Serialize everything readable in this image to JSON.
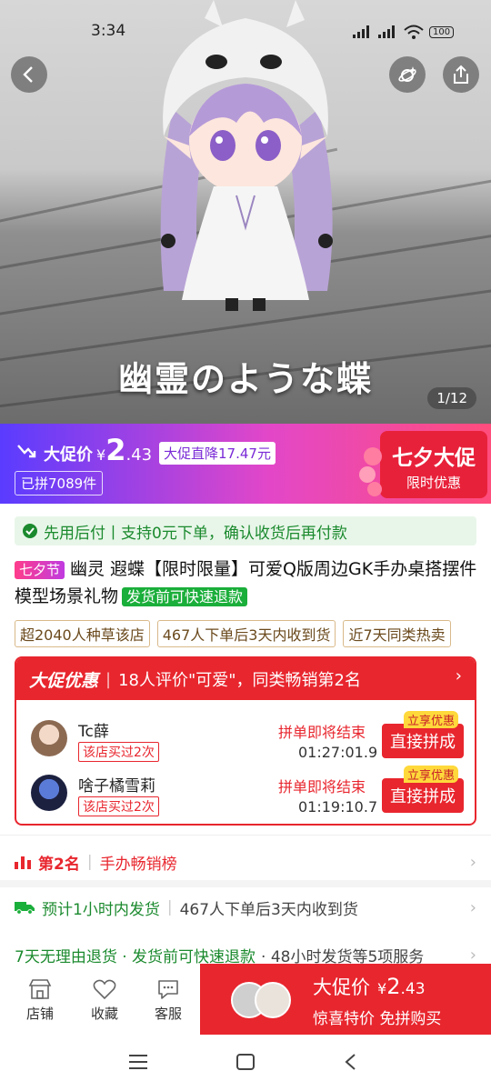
{
  "status_bar": {
    "time": "3:34",
    "battery": "100"
  },
  "gallery": {
    "overlay_title": "幽霊のような蝶",
    "counter": "1/12"
  },
  "promo": {
    "label": "大促价",
    "currency": "¥",
    "price_int": "2",
    "price_dec": ".43",
    "drop_tag": "大促直降17.47元",
    "sold": "已拼7089件",
    "festival_title": "七夕大促",
    "festival_sub": "限时优惠"
  },
  "guarantee": {
    "text": "先用后付丨支持0元下单，确认收货后再付款"
  },
  "product": {
    "festival_badge": "七夕节",
    "title": "幽灵 遐蝶【限时限量】可爱Q版周边GK手办桌搭摆件模型场景礼物",
    "refund_badge": "发货前可快速退款"
  },
  "chips": [
    "超2040人种草该店",
    "467人下单后3天内收到货",
    "近7天同类热卖"
  ],
  "promo_card": {
    "brand": "大促优惠",
    "summary": "18人评价\"可爱\"，同类畅销第2名",
    "groups": [
      {
        "name": "Tc薛",
        "bought": "该店买过2次",
        "end_label": "拼单即将结束",
        "time": "01:27:01.9",
        "tag": "立享优惠",
        "button": "直接拼成"
      },
      {
        "name": "啥子橘雪莉",
        "bought": "该店买过2次",
        "end_label": "拼单即将结束",
        "time": "01:19:10.7",
        "tag": "立享优惠",
        "button": "直接拼成"
      }
    ]
  },
  "ranking": {
    "rank": "第2名",
    "category": "手办畅销榜"
  },
  "shipping": {
    "primary": "预计1小时内发货",
    "secondary": "467人下单后3天内收到货"
  },
  "services": {
    "highlight": "7天无理由退货 · 发货前可快速退款",
    "rest": "· 48小时发货等5项服务"
  },
  "bottom_bar": {
    "tabs": [
      "店铺",
      "收藏",
      "客服"
    ],
    "buy": {
      "label": "大促价",
      "currency": "¥",
      "price_int": "2",
      "price_dec": ".43",
      "sub": "惊喜特价 免拼购买"
    }
  },
  "colors": {
    "accent": "#e8262e",
    "green": "#1b8a2e",
    "promo_start": "#5a3cff",
    "promo_end": "#ff4d7c"
  }
}
